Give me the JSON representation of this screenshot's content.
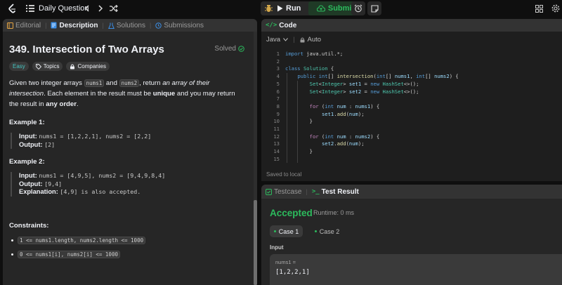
{
  "header": {
    "title": "Daily Question",
    "run_label": "Run",
    "submit_label": "Submit"
  },
  "left_tabs": [
    {
      "label": "Editorial"
    },
    {
      "label": "Description"
    },
    {
      "label": "Solutions"
    },
    {
      "label": "Submissions"
    }
  ],
  "problem": {
    "title": "349. Intersection of Two Arrays",
    "status": "Solved",
    "difficulty": "Easy",
    "topics_label": "Topics",
    "companies_label": "Companies",
    "desc": {
      "p1": "Given two integer arrays ",
      "c1": "nums1",
      "p2": " and ",
      "c2": "nums2",
      "p3": ", return ",
      "em": "an array of their intersection",
      "p4": ". Each element in the result must be ",
      "b1": "unique",
      "p5": " and you may return the result in ",
      "b2": "any order",
      "p6": "."
    },
    "examples": [
      {
        "heading": "Example 1:",
        "input_label": "Input:",
        "input": "nums1 = [1,2,2,1], nums2 = [2,2]",
        "output_label": "Output:",
        "output": "[2]"
      },
      {
        "heading": "Example 2:",
        "input_label": "Input:",
        "input": "nums1 = [4,9,5], nums2 = [9,4,9,8,4]",
        "output_label": "Output:",
        "output": "[9,4]",
        "explanation_label": "Explanation:",
        "explanation_code": "[4,9]",
        "explanation_text": " is also accepted."
      }
    ],
    "constraints_heading": "Constraints:",
    "constraints": [
      "1 <= nums1.length, nums2.length <= 1000",
      "0 <= nums1[i], nums2[i] <= 1000"
    ]
  },
  "code_panel": {
    "title": "Code",
    "language": "Java",
    "autosave": "Auto",
    "saved": "Saved to local",
    "line_numbers": [
      "1",
      "2",
      "3",
      "4",
      "5",
      "6",
      "7",
      "8",
      "9",
      "10",
      "11",
      "12",
      "13",
      "14",
      "15"
    ]
  },
  "result_panel": {
    "tabs": [
      {
        "label": "Testcase"
      },
      {
        "label": "Test Result"
      }
    ],
    "verdict": "Accepted",
    "runtime": "Runtime: 0 ms",
    "cases": [
      {
        "label": "Case 1"
      },
      {
        "label": "Case 2"
      }
    ],
    "input_label": "Input",
    "param_name": "nums1 =",
    "param_value": "[1,2,2,1]"
  },
  "colors": {
    "accepted": "#2cbb5d",
    "easy": "#46c6c2",
    "keyword": "#569cd6",
    "type": "#4ec9b0"
  }
}
